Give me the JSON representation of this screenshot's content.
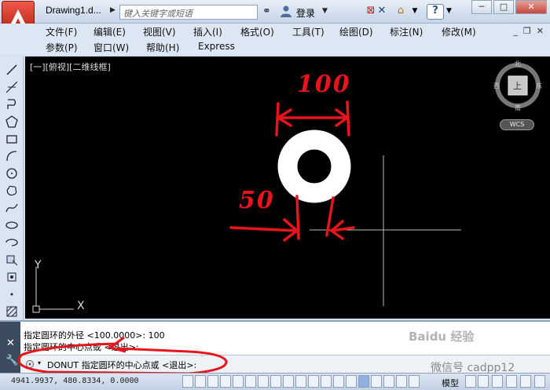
{
  "title_bar": {
    "document_title": "Drawing1.d...",
    "search_placeholder": "键入关键字或短语",
    "login_label": "登录"
  },
  "menu": {
    "row1": [
      "文件(F)",
      "编辑(E)",
      "视图(V)",
      "插入(I)",
      "格式(O)",
      "工具(T)",
      "绘图(D)",
      "标注(N)",
      "修改(M)"
    ],
    "row2": [
      "参数(P)",
      "窗口(W)",
      "帮助(H)",
      "Express"
    ]
  },
  "canvas": {
    "view_label": "[一][俯视][二维线框]",
    "ucs_y": "Y",
    "ucs_x": "X",
    "viewcube": {
      "north": "北",
      "south": "南",
      "east": "东",
      "west": "西",
      "face": "上",
      "wcs": "WCS"
    },
    "annotations": {
      "outer_dim": "100",
      "inner_dim": "50"
    }
  },
  "command": {
    "history_1": "指定圆环的外径 <100.0000>: 100",
    "history_2": "指定圆环的中心点或 <退出>:",
    "prompt": "DONUT 指定圆环的中心点或 <退出>:"
  },
  "status": {
    "coords": "4941.9937, 480.8334, 0.0000",
    "model_label": "模型"
  },
  "watermark": {
    "brand": "Baidu 经验",
    "text": "微信号 cadpp12"
  },
  "colors": {
    "annotation_red": "#e8141b",
    "canvas_bg": "#000000",
    "donut": "#ffffff"
  }
}
